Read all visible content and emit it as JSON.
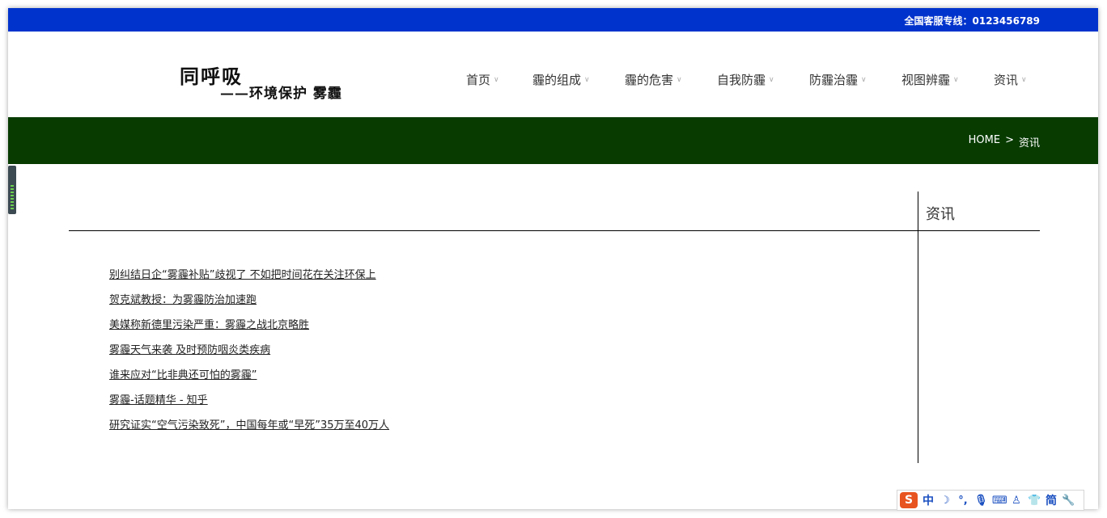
{
  "topbar": {
    "hotline": "全国客服专线：0123456789"
  },
  "logo": {
    "main": "同呼吸",
    "sub": "——环境保护 雾霾"
  },
  "nav": [
    {
      "label": "首页"
    },
    {
      "label": "霾的组成"
    },
    {
      "label": "霾的危害"
    },
    {
      "label": "自我防霾"
    },
    {
      "label": "防霾治霾"
    },
    {
      "label": "视图辨霾"
    },
    {
      "label": "资讯"
    }
  ],
  "breadcrumb": {
    "home": "HOME",
    "separator": ">",
    "current": "资讯"
  },
  "sidebar": {
    "title": "资讯"
  },
  "articles": [
    "别纠结日企“雾霾补贴”歧视了 不如把时间花在关注环保上",
    "贺克斌教授：为雾霾防治加速跑",
    "美媒称新德里污染严重：雾霾之战北京略胜",
    "雾霾天气来袭 及时预防咽炎类疾病",
    "谁来应对“比非典还可怕的雾霾”",
    "雾霾-话题精华 - 知乎",
    "研究证实“空气污染致死”，中国每年或“早死”35万至40万人"
  ],
  "ime": {
    "logo": "S",
    "lang": "中",
    "mode": "简"
  },
  "colors": {
    "topbar": "#0033cc",
    "banner": "#073b00",
    "ime_logo": "#e8541f"
  }
}
